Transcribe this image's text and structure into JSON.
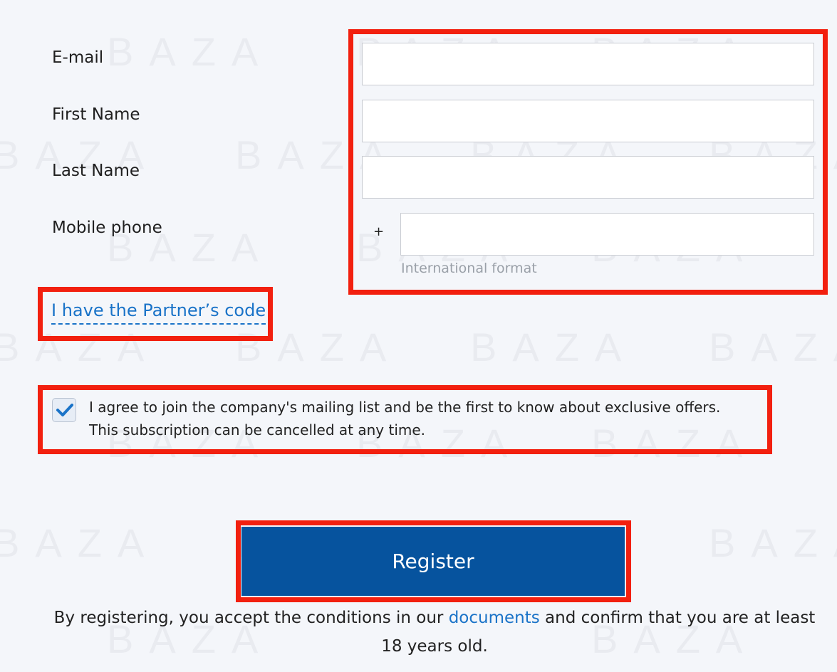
{
  "watermark": "BAZA",
  "form": {
    "email": {
      "label": "E-mail",
      "value": "",
      "placeholder": ""
    },
    "first_name": {
      "label": "First Name",
      "value": "",
      "placeholder": ""
    },
    "last_name": {
      "label": "Last Name",
      "value": "",
      "placeholder": ""
    },
    "mobile": {
      "label": "Mobile phone",
      "prefix": "+",
      "value": "",
      "placeholder": "",
      "hint": "International format"
    }
  },
  "partner_link": "I have the Partner’s code",
  "mailing": {
    "checked": true,
    "text": "I agree to join the company's mailing list and be the first to know about exclusive offers. This subscription can be cancelled at any time."
  },
  "register_button": "Register",
  "terms": {
    "prefix": "By registering, you accept the conditions in our ",
    "link": "documents",
    "suffix": " and confirm that you are at least 18 years old."
  },
  "colors": {
    "accent": "#06539e",
    "link": "#1a73c8",
    "highlight": "#f2200f",
    "background": "#f4f6fa"
  }
}
